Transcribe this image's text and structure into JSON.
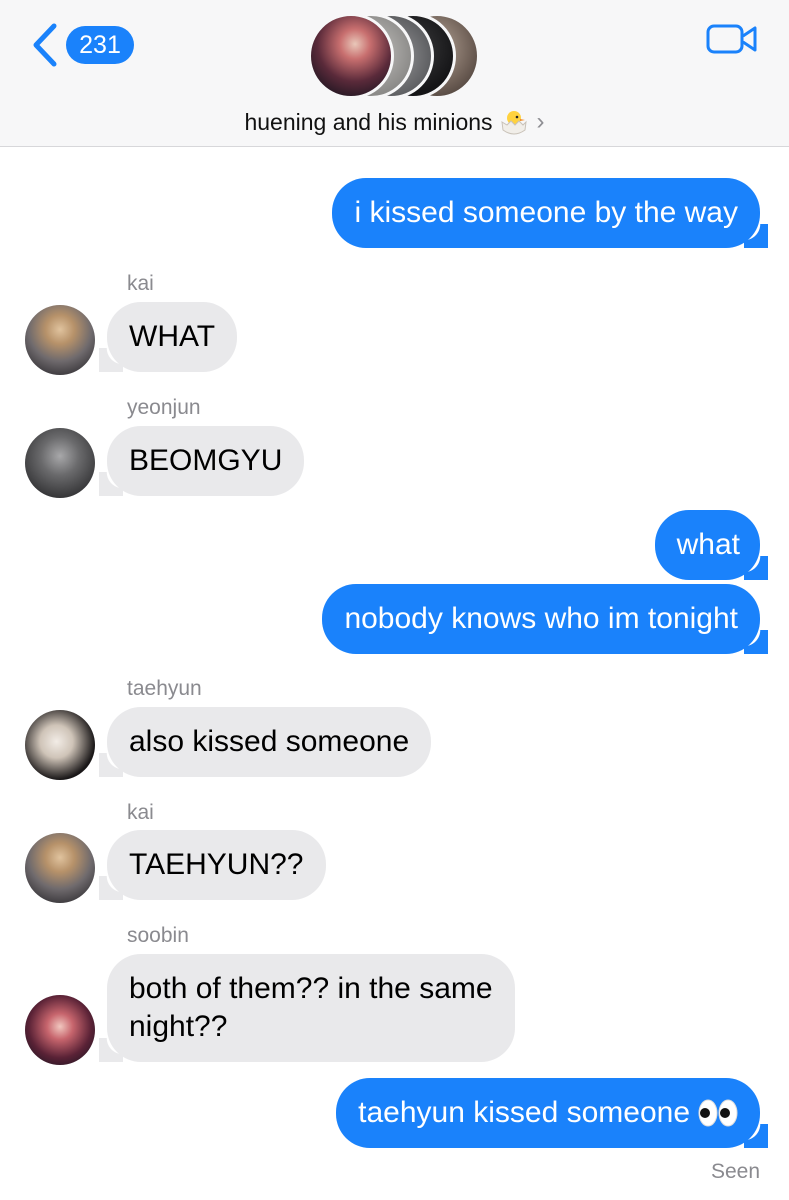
{
  "header": {
    "back_count": "231",
    "group_name": "huening and his minions",
    "chick_icon": "hatching-chick-emoji",
    "accent": "#1a82fb"
  },
  "messages": [
    {
      "id": "m1",
      "direction": "outgoing",
      "text": "i kissed someone by the way"
    },
    {
      "id": "m2",
      "direction": "incoming",
      "sender": "kai",
      "text": "WHAT"
    },
    {
      "id": "m3",
      "direction": "incoming",
      "sender": "yeonjun",
      "text": "BEOMGYU"
    },
    {
      "id": "m4",
      "direction": "outgoing",
      "text": "what"
    },
    {
      "id": "m5",
      "direction": "outgoing",
      "text": "nobody knows who im tonight"
    },
    {
      "id": "m6",
      "direction": "incoming",
      "sender": "taehyun",
      "text": "also kissed someone"
    },
    {
      "id": "m7",
      "direction": "incoming",
      "sender": "kai",
      "text": "TAEHYUN??"
    },
    {
      "id": "m8",
      "direction": "incoming",
      "sender": "soobin",
      "text_line1": "both of them?? in the same",
      "text_line2": "night??"
    },
    {
      "id": "m9",
      "direction": "outgoing",
      "text": "taehyun kissed someone",
      "emoji": "eyes-emoji"
    }
  ],
  "status": "Seen",
  "colors": {
    "outgoing_bubble": "#1a82fb",
    "incoming_bubble": "#e9e9eb",
    "meta_text": "#8a8a8f"
  }
}
